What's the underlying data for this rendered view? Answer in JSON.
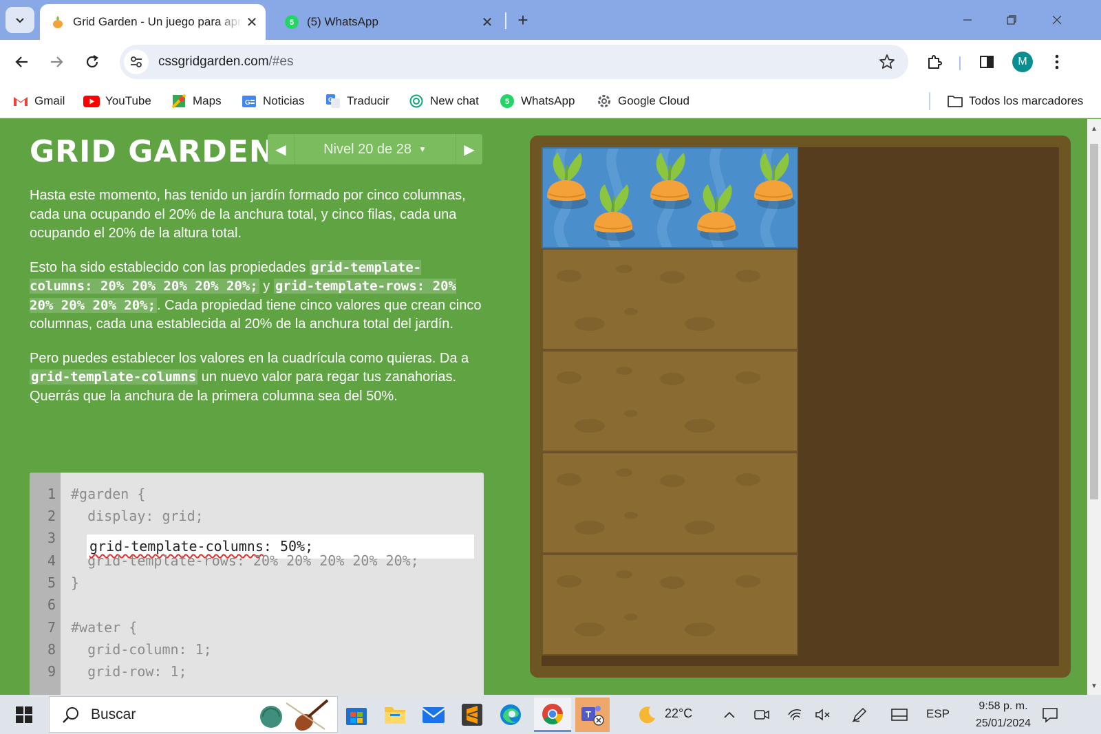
{
  "browser": {
    "tabs": [
      {
        "title": "Grid Garden - Un juego para aprender CSS grid",
        "active": true
      },
      {
        "title": "(5) WhatsApp",
        "active": false
      }
    ],
    "url": {
      "host": "cssgridgarden.com",
      "path": "/#es"
    },
    "avatar_letter": "M",
    "bookmarks": [
      "Gmail",
      "YouTube",
      "Maps",
      "Noticias",
      "Traducir",
      "New chat",
      "WhatsApp",
      "Google Cloud"
    ],
    "all_bookmarks_label": "Todos los marcadores",
    "whatsapp_badge": "5"
  },
  "game": {
    "logo": "GRID GARDEN",
    "level_label": "Nivel 20 de 28",
    "instructions": {
      "p1": "Hasta este momento, has tenido un jardín formado por cinco columnas, cada una ocupando el 20% de la anchura total, y cinco filas, cada una ocupando el 20% de la altura total.",
      "p2_a": "Esto ha sido establecido con las propiedades ",
      "p2_code1": "grid-template-columns: 20% 20% 20% 20% 20%;",
      "p2_b": " y ",
      "p2_code2": "grid-template-rows: 20% 20% 20% 20% 20%;",
      "p2_c": ". Cada propiedad tiene cinco valores que crean cinco columnas, cada una establecida al 20% de la anchura total del jardín.",
      "p3_a": "Pero puedes establecer los valores en la cuadrícula como quieras. Da a ",
      "p3_code": "grid-template-columns",
      "p3_b": " un nuevo valor para regar tus zanahorias. Querrás que la anchura de la primera columna sea del 50%."
    },
    "editor": {
      "line_numbers": [
        "1",
        "2",
        "3",
        "4",
        "5",
        "6",
        "7",
        "8",
        "9"
      ],
      "lines": [
        "#garden {",
        "  display: grid;",
        "",
        "  grid-template-rows: 20% 20% 20% 20% 20%;",
        "}",
        "",
        "#water {",
        "  grid-column: 1;",
        "  grid-row: 1;"
      ],
      "input_property": "grid-template-columns",
      "input_rest": ": 50%;"
    },
    "carrot_count": 5
  },
  "taskbar": {
    "search_placeholder": "Buscar",
    "weather": "22°C",
    "language": "ESP",
    "time": "9:58 p. m.",
    "date": "25/01/2024"
  },
  "colors": {
    "page_bg": "#5fa343",
    "soil": "#8a6b32",
    "water": "#4a8fcc",
    "carrot": "#f3a23a",
    "leaf": "#8cc63f"
  }
}
